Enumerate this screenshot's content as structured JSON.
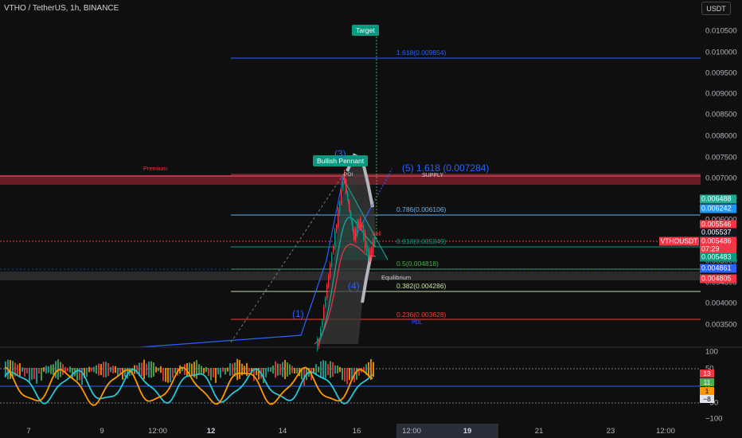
{
  "header": {
    "symbol_title": "VTHO / TetherUS, 1h, BINANCE",
    "currency_button": "USDT"
  },
  "price_axis": {
    "ticks": [
      "0.010500",
      "0.010000",
      "0.009500",
      "0.009000",
      "0.008500",
      "0.008000",
      "0.007500",
      "0.007000",
      "0.006500",
      "0.006000",
      "0.005500",
      "0.005000",
      "0.004500",
      "0.004000",
      "0.003500"
    ],
    "badges": [
      {
        "text": "0.006488",
        "color": "#22ab94"
      },
      {
        "text": "0.006242",
        "color": "#2196f3"
      },
      {
        "text": "0.005546",
        "color": "#f23645"
      },
      {
        "text": "0.005537",
        "color": "#131722"
      },
      {
        "text": "0.005486",
        "color": "#f23645"
      },
      {
        "text": "07:29",
        "color": "#f23645"
      },
      {
        "text": "0.005483",
        "color": "#089981"
      },
      {
        "text": "0.004861",
        "color": "#2962ff"
      },
      {
        "text": "0.004805",
        "color": "#f23645"
      }
    ],
    "symbol_badge": "VTHOUSDT"
  },
  "oscillator_axis": {
    "ticks": [
      "100",
      "50",
      "0",
      "−50",
      "−100"
    ],
    "badges": [
      {
        "text": "13",
        "color": "#f23645",
        "fg": "#ffffff"
      },
      {
        "text": "11",
        "color": "#4caf50",
        "fg": "#ffffff"
      },
      {
        "text": "1",
        "color": "#ff9800",
        "fg": "#000000"
      },
      {
        "text": "−8",
        "color": "#e0e3eb",
        "fg": "#000000"
      }
    ]
  },
  "time_axis": {
    "ticks": [
      {
        "text": "7",
        "bold": false
      },
      {
        "text": "9",
        "bold": false
      },
      {
        "text": "12:00",
        "bold": false
      },
      {
        "text": "12",
        "bold": true
      },
      {
        "text": "14",
        "bold": false
      },
      {
        "text": "16",
        "bold": false
      },
      {
        "text": "12:00",
        "bold": false
      },
      {
        "text": "19",
        "bold": true
      },
      {
        "text": "21",
        "bold": false
      },
      {
        "text": "23",
        "bold": false
      },
      {
        "text": "12:00",
        "bold": false
      }
    ]
  },
  "annotations": {
    "target": "Target",
    "bullish_pennant": "Bullish Pennant",
    "premium": "Premium",
    "equilibrium": "Equilibrium",
    "poi": "POI",
    "supply": "SUPPLY",
    "pdl": "PDL",
    "wave_1": "(1)",
    "wave_3": "(3)",
    "wave_4": "(4)",
    "wave_5": "(5) 1.618 (0.007284)",
    "sell": "Sell"
  },
  "fibonacci": [
    {
      "text": "1.618(0.009854)",
      "color": "#2962ff"
    },
    {
      "text": "0.786(0.006106)",
      "color": "#64b5f6"
    },
    {
      "text": "0.618(0.005349)",
      "color": "#089981"
    },
    {
      "text": "0.5(0.004818)",
      "color": "#4caf50"
    },
    {
      "text": "0.382(0.004286)",
      "color": "#c5e1a5"
    },
    {
      "text": "0.236(0.003628)",
      "color": "#f44336"
    }
  ],
  "colors": {
    "background": "#0f0f0f",
    "up": "#089981",
    "down": "#f23645",
    "accent": "#2962ff"
  }
}
